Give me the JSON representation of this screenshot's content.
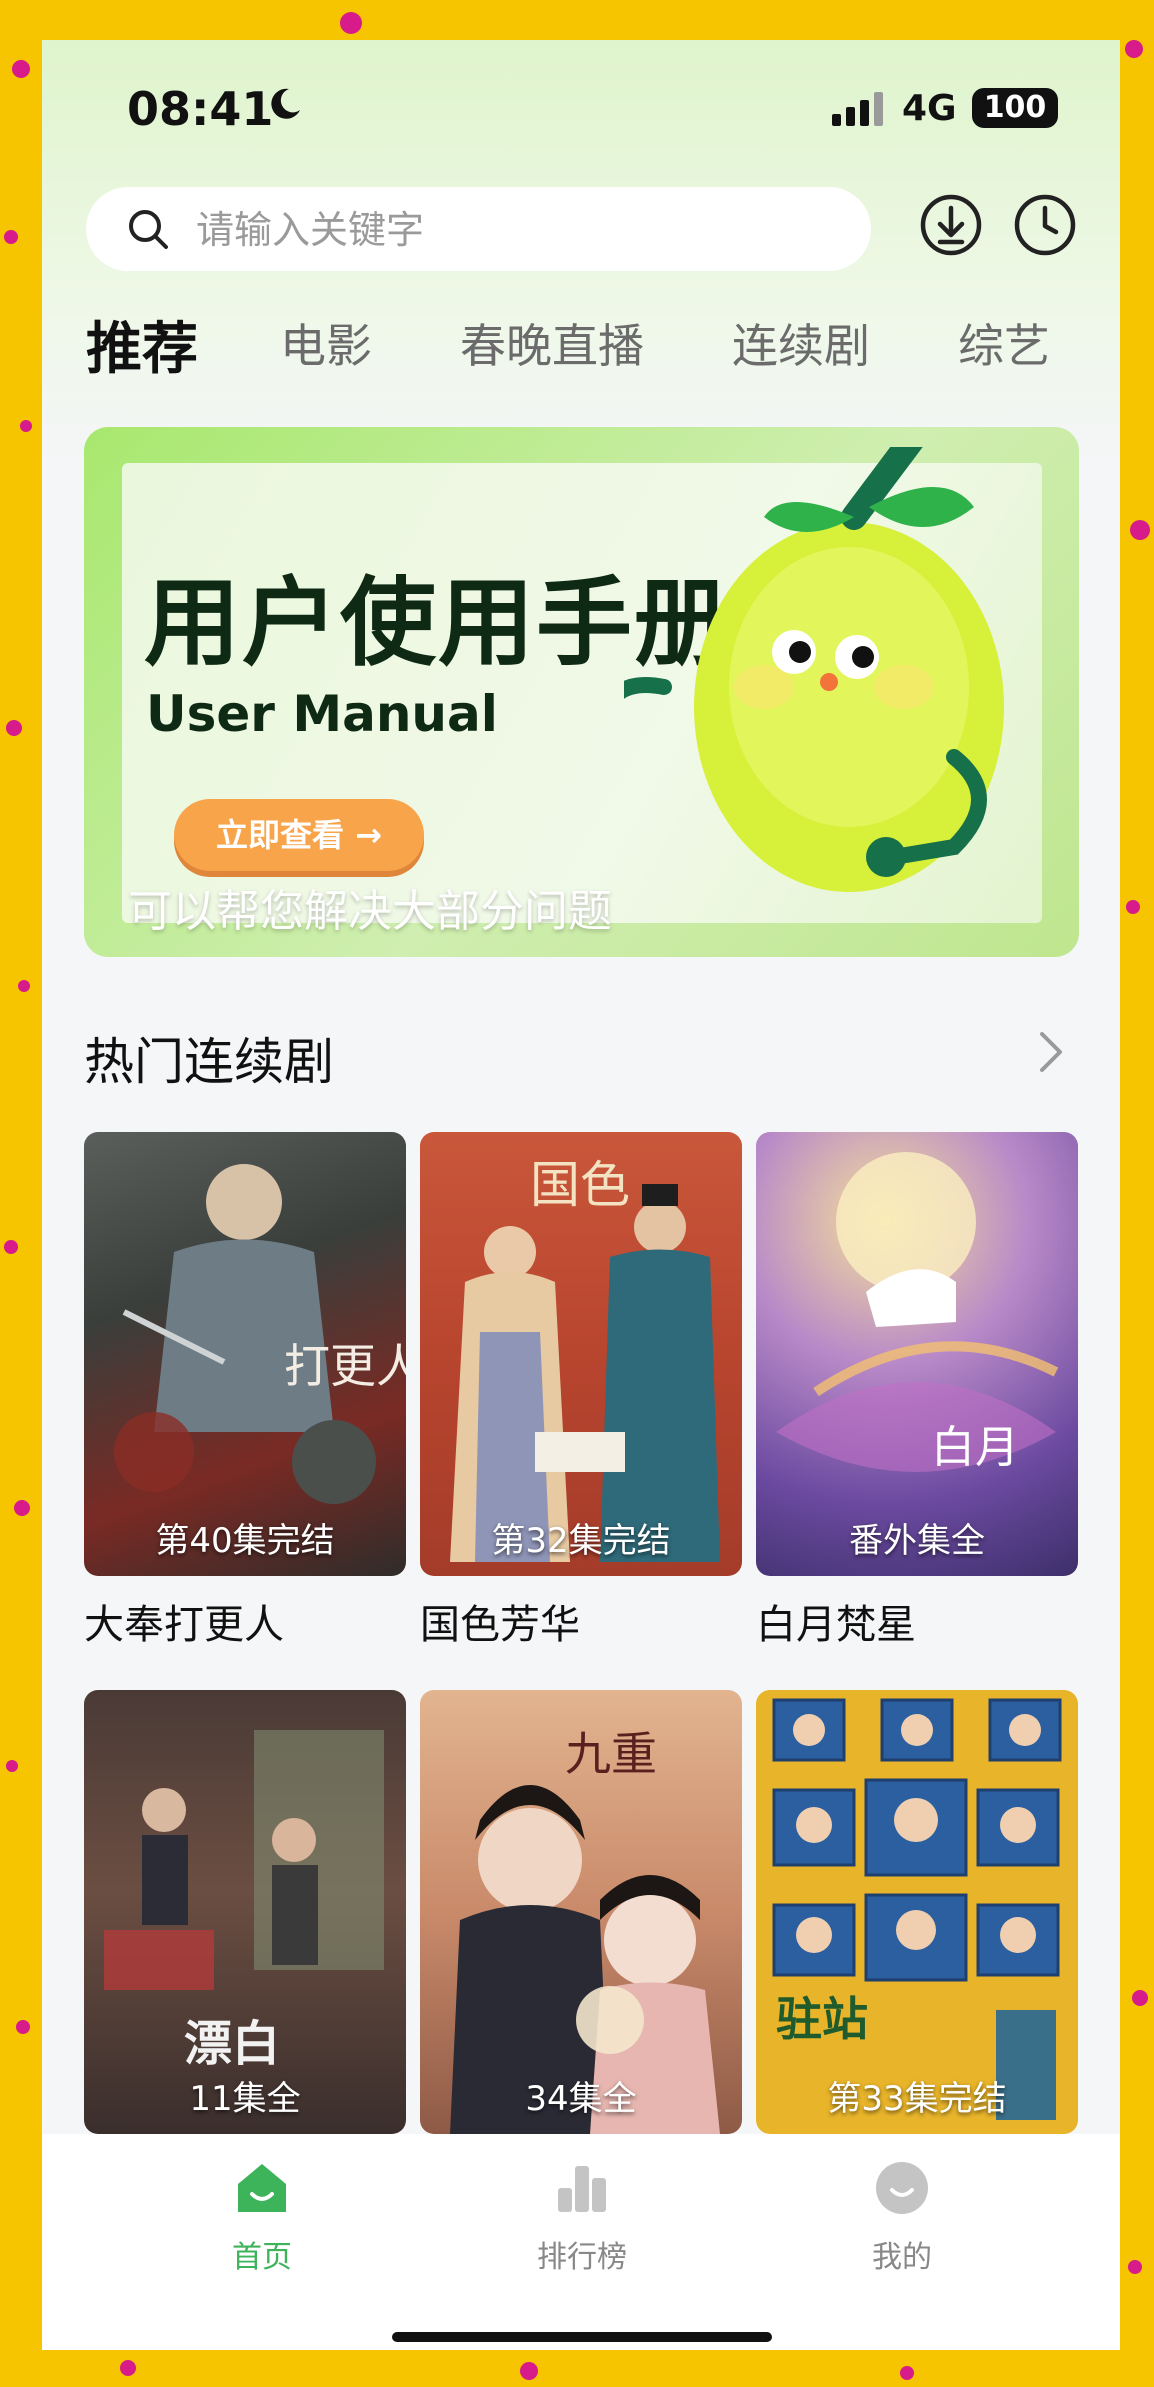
{
  "status": {
    "time": "08:41",
    "network": "4G",
    "battery": "100"
  },
  "search": {
    "placeholder": "请输入关键字"
  },
  "tabs": [
    {
      "label": "推荐",
      "active": true
    },
    {
      "label": "电影"
    },
    {
      "label": "春晚直播"
    },
    {
      "label": "连续剧"
    },
    {
      "label": "综艺"
    }
  ],
  "banner": {
    "title": "用户使用手册",
    "subtitle": "User Manual",
    "button": "立即查看 →",
    "caption": "可以帮您解决大部分问题"
  },
  "section": {
    "title": "热门连续剧"
  },
  "shows": [
    {
      "title": "大奉打更人",
      "badge": "第40集完结"
    },
    {
      "title": "国色芳华",
      "badge": "第32集完结"
    },
    {
      "title": "白月梵星",
      "badge": "番外集全"
    },
    {
      "title": "漂白",
      "badge": "11集全"
    },
    {
      "title": "九重紫",
      "badge": "34集全"
    },
    {
      "title": "驻站",
      "badge": "第33集完结"
    }
  ],
  "nav": [
    {
      "label": "首页",
      "icon": "home-icon",
      "active": true
    },
    {
      "label": "排行榜",
      "icon": "bar-chart-icon"
    },
    {
      "label": "我的",
      "icon": "profile-icon"
    }
  ],
  "colors": {
    "accent": "#3db35a",
    "frame": "#f7c500",
    "frame_dots": "#d81b8a",
    "banner_button": "#f7a44b"
  }
}
